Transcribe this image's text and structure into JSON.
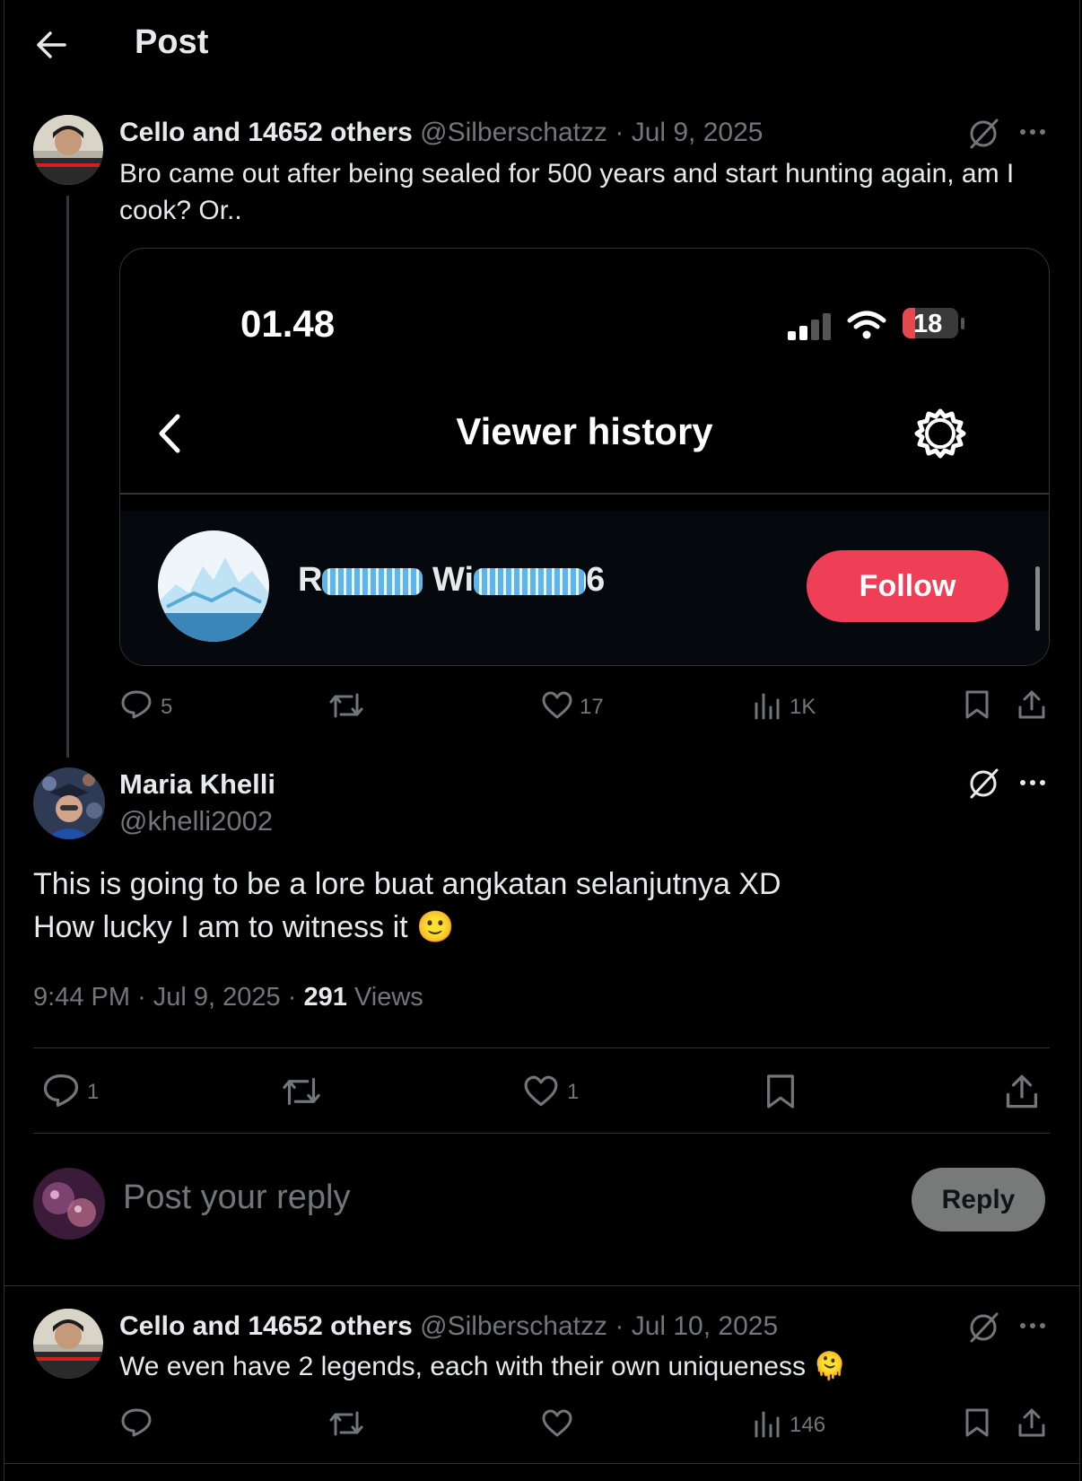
{
  "header": {
    "title": "Post",
    "back_icon": "arrow-left-icon"
  },
  "tweet1": {
    "display_name": "Cello and 14652 others",
    "handle": "@Silberschatzz",
    "date": "Jul 9, 2025",
    "text": "Bro came out after being sealed for 500 years and start hunting again, am I cook? Or..",
    "media": {
      "time": "01.48",
      "battery": "18",
      "title": "Viewer history",
      "username_visible_start": "R",
      "username_visible_mid": "Wi",
      "username_visible_end": "6",
      "follow_label": "Follow",
      "accent": "#ee3f57"
    },
    "stats": {
      "replies": "5",
      "likes": "17",
      "views": "1K"
    }
  },
  "main_tweet": {
    "display_name": "Maria Khelli",
    "handle": "@khelli2002",
    "line1": "This is going to be a lore buat angkatan selanjutnya XD",
    "line2": "How lucky I am to witness it",
    "emoji": "🙂",
    "time": "9:44 PM",
    "date": "Jul 9, 2025",
    "views_count": "291",
    "views_label": "Views",
    "stats": {
      "replies": "1",
      "likes": "1"
    }
  },
  "composer": {
    "placeholder": "Post your reply",
    "reply_label": "Reply"
  },
  "tweet2": {
    "display_name": "Cello and 14652 others",
    "handle": "@Silberschatzz",
    "date": "Jul 10, 2025",
    "text": "We even have 2 legends, each with their own uniqueness",
    "emoji": "🫠",
    "stats": {
      "views": "146"
    }
  },
  "separator": "·"
}
